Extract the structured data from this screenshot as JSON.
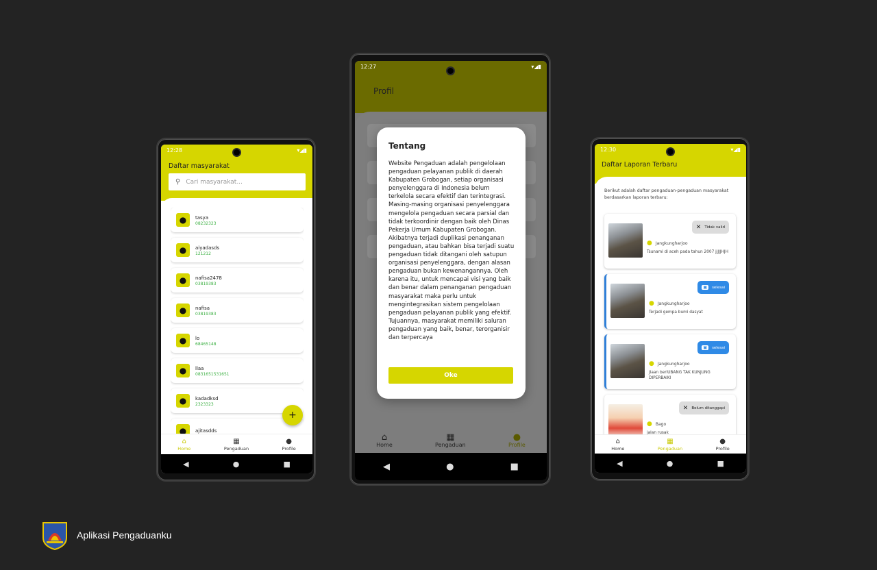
{
  "phone1": {
    "time": "12:28",
    "title": "Daftar masyarakat",
    "search_placeholder": "Cari masyarakat...",
    "people": [
      {
        "name": "tasya",
        "phone": "08232323"
      },
      {
        "name": "aiyadasds",
        "phone": "121212"
      },
      {
        "name": "nafisa2478",
        "phone": "03819383"
      },
      {
        "name": "nafisa",
        "phone": "03819383"
      },
      {
        "name": "lo",
        "phone": "68465148"
      },
      {
        "name": "llaa",
        "phone": "0831651531651"
      },
      {
        "name": "kadadksd",
        "phone": "2323323"
      },
      {
        "name": "ajitasdds",
        "phone": ""
      }
    ],
    "fab": "+",
    "nav": {
      "home": "Home",
      "pengaduan": "Pengaduan",
      "profile": "Profile"
    }
  },
  "phone2": {
    "time": "12:27",
    "title": "Profil",
    "modal_title": "Tentang",
    "modal_text": "Website Pengaduan adalah pengelolaan pengaduan pelayanan publik di daerah Kabupaten Grobogan, setiap organisasi penyelenggara di Indonesia belum terkelola secara efektif dan terintegrasi. Masing-masing organisasi penyelenggara mengelola pengaduan secara parsial dan tidak terkoordinir dengan baik oleh Dinas Pekerja Umum Kabupaten Grobogan. Akibatnya terjadi duplikasi penanganan pengaduan, atau bahkan bisa terjadi suatu pengaduan tidak ditangani oleh satupun organisasi penyelenggara, dengan alasan pengaduan bukan kewenangannya. Oleh karena itu, untuk mencapai visi yang baik dan benar dalam penanganan pengaduan masyarakat maka perlu untuk mengintegrasikan sistem pengelolaan pengaduan pelayanan publik yang efektif. Tujuannya, masyarakat memiliki saluran pengaduan yang baik, benar, terorganisir dan terpercaya",
    "ok_label": "Oke",
    "nav": {
      "home": "Home",
      "pengaduan": "Pengaduan",
      "profile": "Profile"
    }
  },
  "phone3": {
    "time": "12:30",
    "title": "Daftar Laporan Terbaru",
    "intro": "Berikut adalah daftar pengaduan-pengaduan masyarakat berdasarkan laporan terbaru:",
    "reports": [
      {
        "status": "Tidak valid",
        "location": "Jangkungharjoo",
        "desc": "Tsunami di aceh pada tahun 2007 jjJJJHJH"
      },
      {
        "status": "selesai",
        "location": "Jangkungharjoo",
        "desc": "Terjadi gempa bumi dasyat"
      },
      {
        "status": "selesai",
        "location": "Jangkungharjoo",
        "desc": "Jlaan berlUBANG TAK KUNJUNG DIPERBAIKI"
      },
      {
        "status": "Belum ditanggapi",
        "location": "Bago",
        "desc": "jalan rusak"
      }
    ],
    "nav": {
      "home": "Home",
      "pengaduan": "Pengaduan",
      "profile": "Profile"
    }
  },
  "brand": {
    "name": "Aplikasi Pengaduanku"
  },
  "colors": {
    "accent": "#d6d600",
    "background": "#232323",
    "blue": "#2f8ae6"
  }
}
